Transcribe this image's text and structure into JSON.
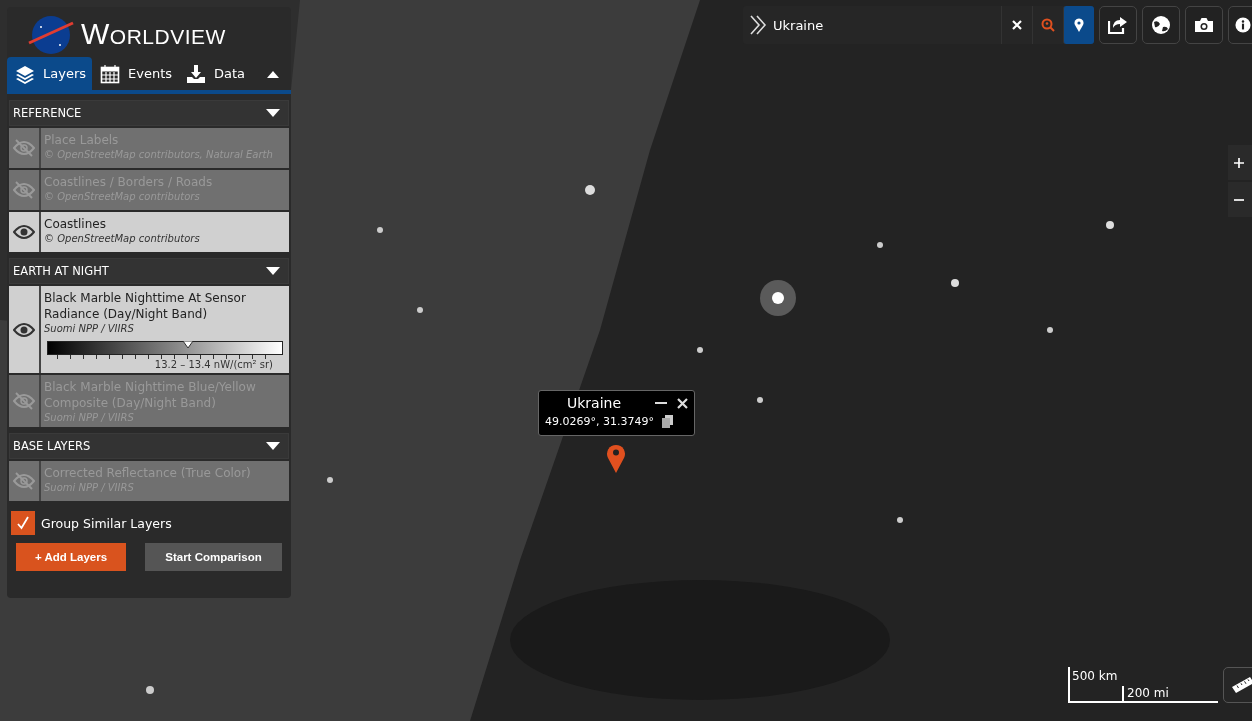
{
  "app": {
    "title": "Worldview"
  },
  "tabs": [
    {
      "label": "Layers",
      "selected": true
    },
    {
      "label": "Events",
      "selected": false
    },
    {
      "label": "Data",
      "selected": false
    }
  ],
  "layer_groups": [
    {
      "title": "REFERENCE",
      "expanded": true,
      "layers": [
        {
          "name": "Place Labels",
          "source": "© OpenStreetMap contributors, Natural Earth",
          "visible": false
        },
        {
          "name": "Coastlines / Borders / Roads",
          "source": "© OpenStreetMap contributors",
          "visible": false
        },
        {
          "name": "Coastlines",
          "source": "© OpenStreetMap contributors",
          "visible": true
        }
      ]
    },
    {
      "title": "EARTH AT NIGHT",
      "expanded": true,
      "layers": [
        {
          "name": "Black Marble Nighttime At Sensor Radiance (Day/Night Band)",
          "source": "Suomi NPP / VIIRS",
          "visible": true,
          "legend": {
            "reading": "13.2 – 13.4 nW/(cm² sr)",
            "level": 0.6
          }
        },
        {
          "name": "Black Marble Nighttime Blue/Yellow Composite (Day/Night Band)",
          "source": "Suomi NPP / VIIRS",
          "visible": false
        }
      ]
    },
    {
      "title": "BASE LAYERS",
      "expanded": true,
      "layers": [
        {
          "name": "Corrected Reflectance (True Color)",
          "source": "Suomi NPP / VIIRS",
          "visible": false
        }
      ]
    }
  ],
  "group_similar": {
    "label": "Group Similar Layers",
    "checked": true
  },
  "buttons": [
    {
      "label": "+ Add Layers",
      "kind": "primary"
    },
    {
      "label": "Start Comparison",
      "kind": "secondary"
    }
  ],
  "search": {
    "value": "Ukraine",
    "marker_selected": true
  },
  "popup": {
    "title": "Ukraine",
    "coordinates": "49.0269°, 31.3749°"
  },
  "scale": {
    "metric": "500 km",
    "imperial": "200 mi"
  }
}
